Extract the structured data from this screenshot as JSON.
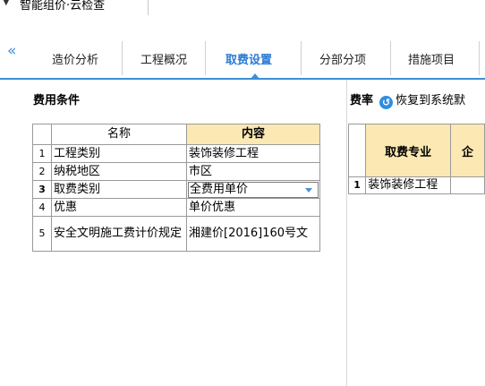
{
  "topbar": {
    "caret": "▼",
    "crumb": "智能组价·云检查"
  },
  "tabs": [
    {
      "label": "造价分析"
    },
    {
      "label": "工程概况"
    },
    {
      "label": "取费设置"
    },
    {
      "label": "分部分项"
    },
    {
      "label": "措施项目"
    }
  ],
  "left_panel": {
    "title": "费用条件",
    "columns": {
      "name": "名称",
      "value": "内容"
    },
    "rows": [
      {
        "idx": "1",
        "name": "工程类别",
        "value": "装饰装修工程"
      },
      {
        "idx": "2",
        "name": "纳税地区",
        "value": "市区"
      },
      {
        "idx": "3",
        "name": "取费类别",
        "value": "全费用单价"
      },
      {
        "idx": "4",
        "name": "优惠",
        "value": "单价优惠"
      },
      {
        "idx": "5",
        "name": "安全文明施工费计价规定",
        "value": "湘建价[2016]160号文"
      }
    ]
  },
  "right_panel": {
    "title": "费率",
    "restore_label": "恢复到系统默",
    "columns": {
      "profession": "取费专业",
      "enterprise": "企"
    },
    "rows": [
      {
        "idx": "1",
        "profession": "装饰装修工程"
      }
    ]
  },
  "colors": {
    "accent": "#3c8fd8",
    "header_fill": "#fbe8b3",
    "icon_blue": "#2f8de0"
  }
}
